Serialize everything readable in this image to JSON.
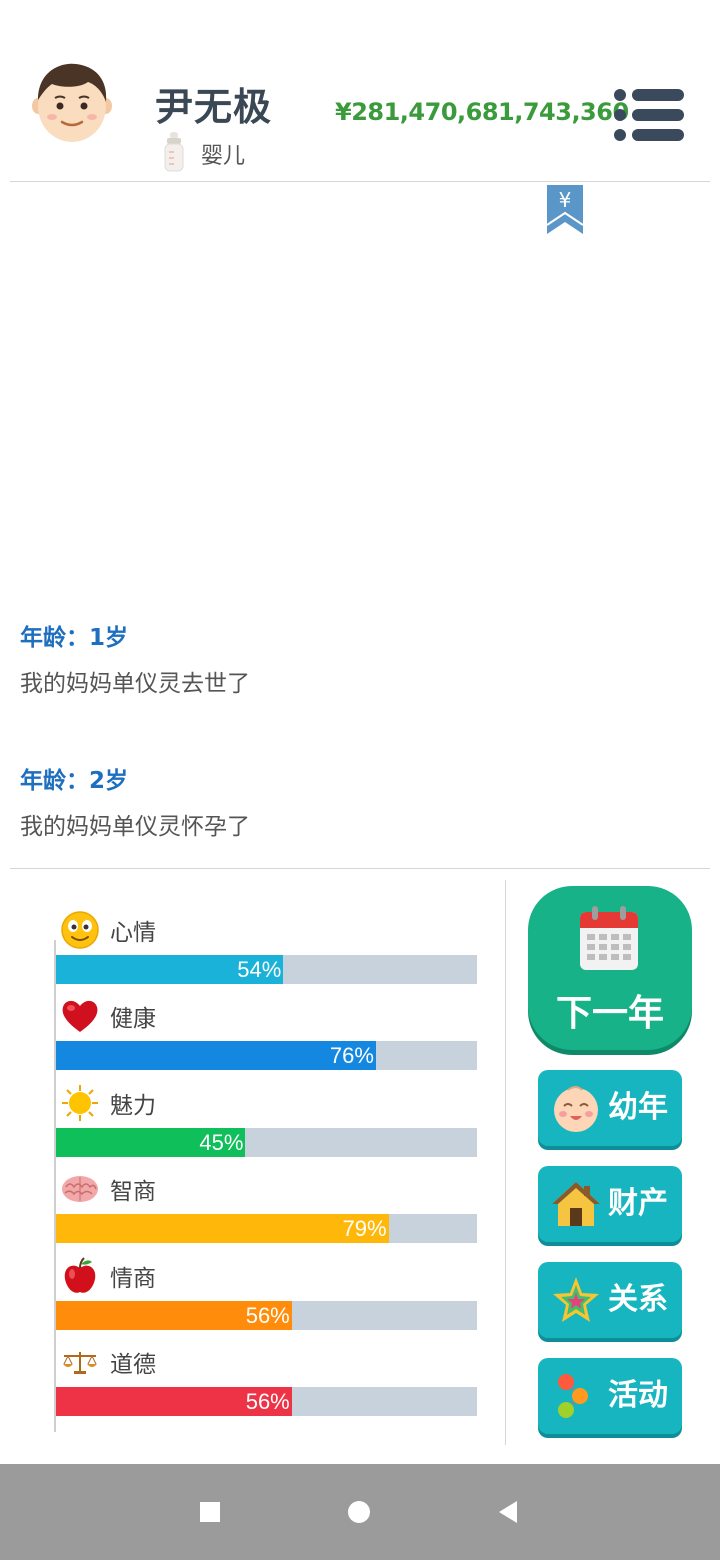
{
  "profile": {
    "name": "尹无极",
    "stage": "婴儿",
    "money": "¥281,470,681,743,360",
    "avatar_icon": "boy-face-icon",
    "stage_icon": "baby-bottle-icon"
  },
  "menu_icon": "list-menu-icon",
  "bookmark_icon": "yen-bookmark-icon",
  "bookmark_symbol": "¥",
  "log": [
    {
      "age": "年龄：1岁",
      "text": "我的妈妈单仪灵去世了"
    },
    {
      "age": "年龄：2岁",
      "text": "我的妈妈单仪灵怀孕了"
    }
  ],
  "stats": [
    {
      "label": "心情",
      "value": 54,
      "pct": "54%",
      "color": "#1ab2d9",
      "icon": "smiley-face-icon"
    },
    {
      "label": "健康",
      "value": 76,
      "pct": "76%",
      "color": "#1488e0",
      "icon": "heart-icon"
    },
    {
      "label": "魅力",
      "value": 45,
      "pct": "45%",
      "color": "#0fbf59",
      "icon": "sun-icon"
    },
    {
      "label": "智商",
      "value": 79,
      "pct": "79%",
      "color": "#ffb80a",
      "icon": "brain-icon"
    },
    {
      "label": "情商",
      "value": 56,
      "pct": "56%",
      "color": "#ff8c0a",
      "icon": "apple-icon"
    },
    {
      "label": "道德",
      "value": 56,
      "pct": "56%",
      "color": "#ee3346",
      "icon": "scales-icon"
    }
  ],
  "next_year": {
    "label": "下一年",
    "icon": "calendar-icon"
  },
  "side_buttons": [
    {
      "label": "幼年",
      "icon": "baby-face-icon"
    },
    {
      "label": "财产",
      "icon": "house-icon"
    },
    {
      "label": "关系",
      "icon": "star-icon"
    },
    {
      "label": "活动",
      "icon": "activity-dots-icon"
    }
  ],
  "navbar": {
    "icons": [
      "square-recent-icon",
      "circle-home-icon",
      "triangle-back-icon"
    ]
  }
}
